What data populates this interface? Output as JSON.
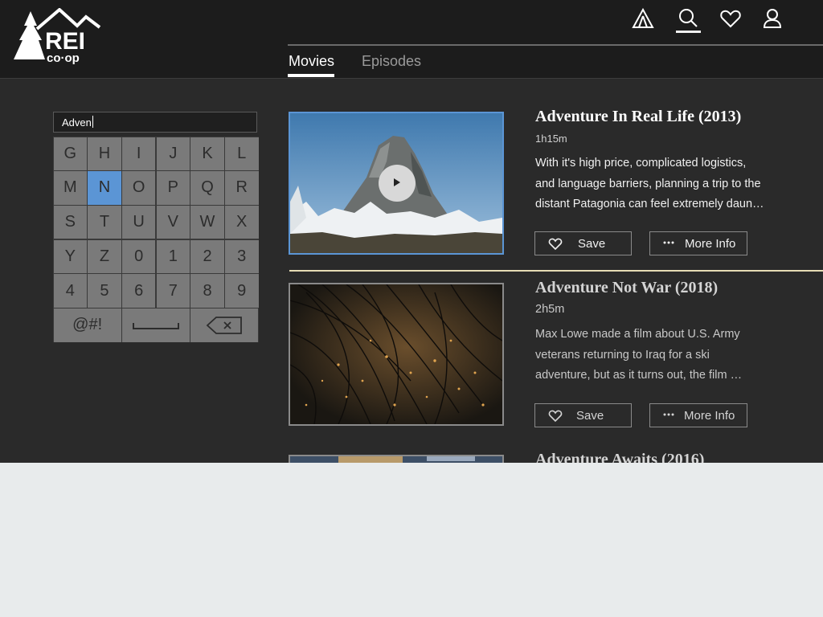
{
  "brand": {
    "name": "REI co-op",
    "logo_text_top": "REI",
    "logo_text_bottom": "co·op"
  },
  "nav": {
    "icons": [
      "tent-icon",
      "search-icon",
      "heart-icon",
      "user-icon"
    ],
    "tabs": [
      {
        "label": "Movies",
        "active": true
      },
      {
        "label": "Episodes",
        "active": false
      }
    ]
  },
  "search": {
    "query": "Adven"
  },
  "keyboard": {
    "rows": [
      [
        "G",
        "H",
        "I",
        "J",
        "K",
        "L"
      ],
      [
        "M",
        "N",
        "O",
        "P",
        "Q",
        "R"
      ],
      [
        "S",
        "T",
        "U",
        "V",
        "W",
        "X"
      ],
      [
        "Y",
        "Z",
        "0",
        "1",
        "2",
        "3"
      ],
      [
        "4",
        "5",
        "6",
        "7",
        "8",
        "9"
      ]
    ],
    "selected_key": "N",
    "symbols_label": "@#!",
    "space_icon": "space-bar-icon",
    "backspace_icon": "backspace-icon"
  },
  "results": [
    {
      "title": "Adventure In Real Life (2013)",
      "duration": "1h15m",
      "description_lines": [
        "With it's high price, complicated logistics,",
        "and language barriers, planning a trip to the",
        "distant Patagonia can feel extremely daun…"
      ],
      "save_label": "Save",
      "info_label": "More Info",
      "focused": true
    },
    {
      "title": "Adventure Not War (2018)",
      "duration": "2h5m",
      "description_lines": [
        "Max Lowe made a film about U.S. Army",
        "veterans returning to Iraq for a ski",
        "adventure, but as it turns out, the film …"
      ],
      "save_label": "Save",
      "info_label": "More Info",
      "focused": false
    },
    {
      "title": "Adventure Awaits (2016)",
      "focused": false
    }
  ],
  "colors": {
    "background": "#2a2a2a",
    "topbar": "#1c1c1c",
    "key": "#7a7a7a",
    "key_selected": "#5b95d5",
    "divider": "#e6dcb4",
    "below_viewport": "#e8ebec"
  }
}
